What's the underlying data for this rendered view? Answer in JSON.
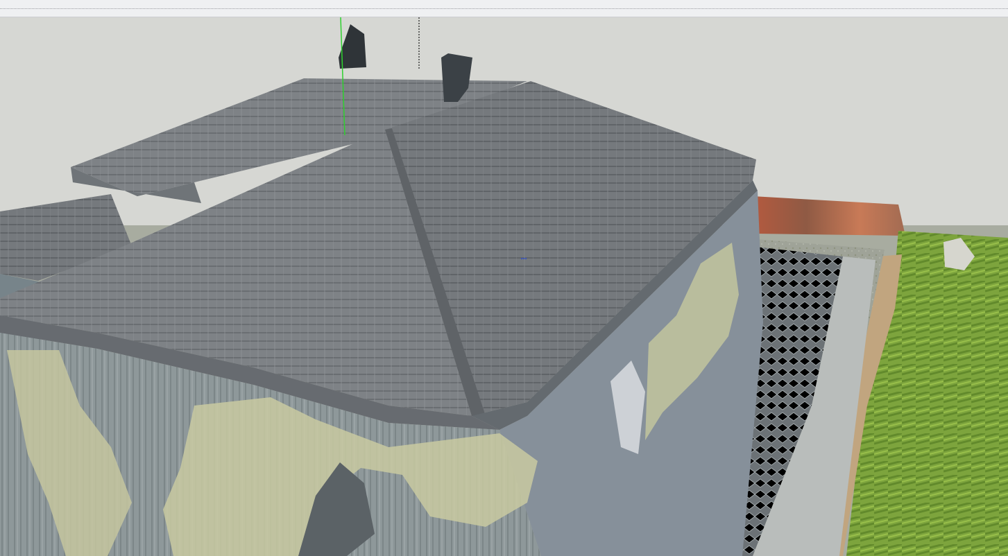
{
  "window": {
    "toolbar_strip": "",
    "viewport": "3d-model-viewport"
  },
  "scene": {
    "icons": {
      "green_axis": "green-axis-icon",
      "origin_axis": "black-origin-axis-icon",
      "cursor": "dotted-cursor-icon"
    }
  },
  "colors": {
    "sky": "#d6d7d3",
    "roof": "#7f8387",
    "wall": "#8d9698",
    "lawn": "#7fa23d",
    "accent_green_axis": "#2fd12f"
  }
}
